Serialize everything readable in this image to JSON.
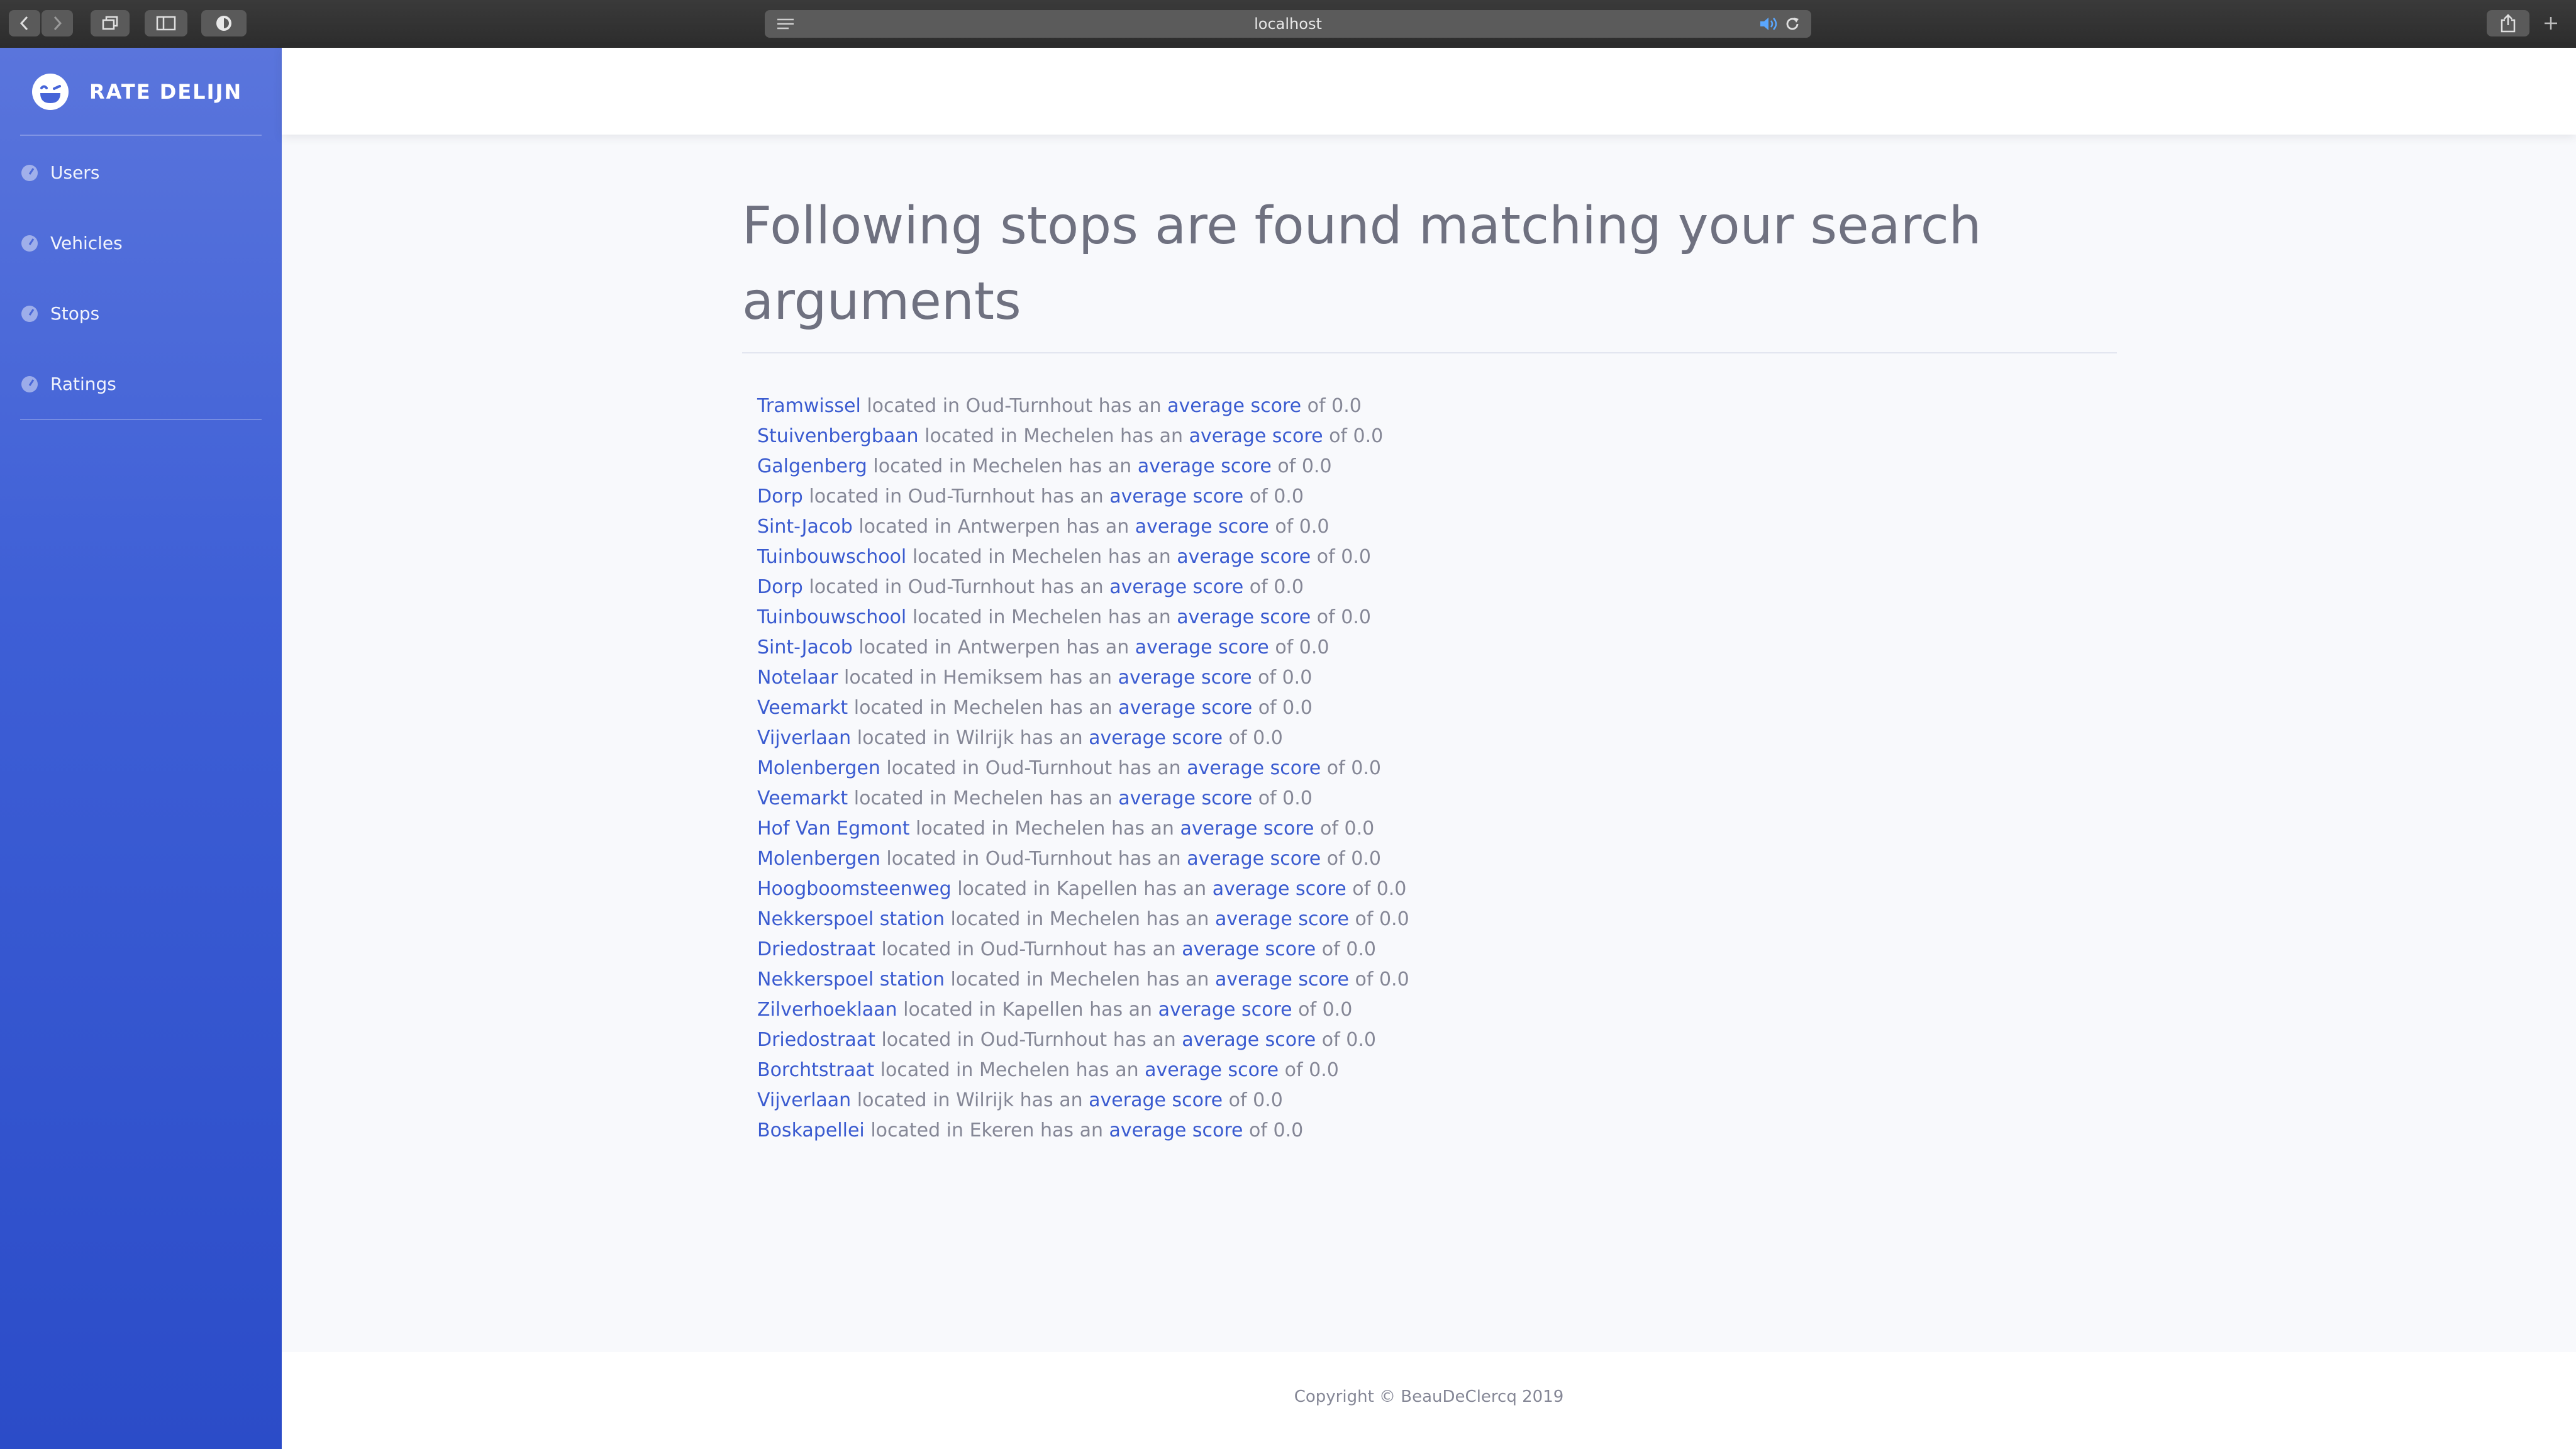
{
  "browser": {
    "url": "localhost"
  },
  "sidebar": {
    "brand": "RATE DELIJN",
    "items": [
      {
        "label": "Users"
      },
      {
        "label": "Vehicles"
      },
      {
        "label": "Stops"
      },
      {
        "label": "Ratings"
      }
    ]
  },
  "main": {
    "heading": "Following stops are found matching your search arguments",
    "results": [
      {
        "stop": "Tramwissel",
        "loc_prefix": "located in",
        "location": "Oud-Turnhout",
        "has": "has an",
        "score_link": "average score",
        "of": "of",
        "score": "0.0"
      },
      {
        "stop": "Stuivenbergbaan",
        "loc_prefix": "located in",
        "location": "Mechelen",
        "has": "has an",
        "score_link": "average score",
        "of": "of",
        "score": "0.0"
      },
      {
        "stop": "Galgenberg",
        "loc_prefix": "located in",
        "location": "Mechelen",
        "has": "has an",
        "score_link": "average score",
        "of": "of",
        "score": "0.0"
      },
      {
        "stop": "Dorp",
        "loc_prefix": "located in",
        "location": "Oud-Turnhout",
        "has": "has an",
        "score_link": "average score",
        "of": "of",
        "score": "0.0"
      },
      {
        "stop": "Sint-Jacob",
        "loc_prefix": "located in",
        "location": "Antwerpen",
        "has": "has an",
        "score_link": "average score",
        "of": "of",
        "score": "0.0"
      },
      {
        "stop": "Tuinbouwschool",
        "loc_prefix": "located in",
        "location": "Mechelen",
        "has": "has an",
        "score_link": "average score",
        "of": "of",
        "score": "0.0"
      },
      {
        "stop": "Dorp",
        "loc_prefix": "located in",
        "location": "Oud-Turnhout",
        "has": "has an",
        "score_link": "average score",
        "of": "of",
        "score": "0.0"
      },
      {
        "stop": "Tuinbouwschool",
        "loc_prefix": "located in",
        "location": "Mechelen",
        "has": "has an",
        "score_link": "average score",
        "of": "of",
        "score": "0.0"
      },
      {
        "stop": "Sint-Jacob",
        "loc_prefix": "located in",
        "location": "Antwerpen",
        "has": "has an",
        "score_link": "average score",
        "of": "of",
        "score": "0.0"
      },
      {
        "stop": "Notelaar",
        "loc_prefix": "located in",
        "location": "Hemiksem",
        "has": "has an",
        "score_link": "average score",
        "of": "of",
        "score": "0.0"
      },
      {
        "stop": "Veemarkt",
        "loc_prefix": "located in",
        "location": "Mechelen",
        "has": "has an",
        "score_link": "average score",
        "of": "of",
        "score": "0.0"
      },
      {
        "stop": "Vijverlaan",
        "loc_prefix": "located in",
        "location": "Wilrijk",
        "has": "has an",
        "score_link": "average score",
        "of": "of",
        "score": "0.0"
      },
      {
        "stop": "Molenbergen",
        "loc_prefix": "located in",
        "location": "Oud-Turnhout",
        "has": "has an",
        "score_link": "average score",
        "of": "of",
        "score": "0.0"
      },
      {
        "stop": "Veemarkt",
        "loc_prefix": "located in",
        "location": "Mechelen",
        "has": "has an",
        "score_link": "average score",
        "of": "of",
        "score": "0.0"
      },
      {
        "stop": "Hof Van Egmont",
        "loc_prefix": "located in",
        "location": "Mechelen",
        "has": "has an",
        "score_link": "average score",
        "of": "of",
        "score": "0.0"
      },
      {
        "stop": "Molenbergen",
        "loc_prefix": "located in",
        "location": "Oud-Turnhout",
        "has": "has an",
        "score_link": "average score",
        "of": "of",
        "score": "0.0"
      },
      {
        "stop": "Hoogboomsteenweg",
        "loc_prefix": "located in",
        "location": "Kapellen",
        "has": "has an",
        "score_link": "average score",
        "of": "of",
        "score": "0.0"
      },
      {
        "stop": "Nekkerspoel station",
        "loc_prefix": "located in",
        "location": "Mechelen",
        "has": "has an",
        "score_link": "average score",
        "of": "of",
        "score": "0.0"
      },
      {
        "stop": "Driedostraat",
        "loc_prefix": "located in",
        "location": "Oud-Turnhout",
        "has": "has an",
        "score_link": "average score",
        "of": "of",
        "score": "0.0"
      },
      {
        "stop": "Nekkerspoel station",
        "loc_prefix": "located in",
        "location": "Mechelen",
        "has": "has an",
        "score_link": "average score",
        "of": "of",
        "score": "0.0"
      },
      {
        "stop": "Zilverhoeklaan",
        "loc_prefix": "located in",
        "location": "Kapellen",
        "has": "has an",
        "score_link": "average score",
        "of": "of",
        "score": "0.0"
      },
      {
        "stop": "Driedostraat",
        "loc_prefix": "located in",
        "location": "Oud-Turnhout",
        "has": "has an",
        "score_link": "average score",
        "of": "of",
        "score": "0.0"
      },
      {
        "stop": "Borchtstraat",
        "loc_prefix": "located in",
        "location": "Mechelen",
        "has": "has an",
        "score_link": "average score",
        "of": "of",
        "score": "0.0"
      },
      {
        "stop": "Vijverlaan",
        "loc_prefix": "located in",
        "location": "Wilrijk",
        "has": "has an",
        "score_link": "average score",
        "of": "of",
        "score": "0.0"
      },
      {
        "stop": "Boskapellei",
        "loc_prefix": "located in",
        "location": "Ekeren",
        "has": "has an",
        "score_link": "average score",
        "of": "of",
        "score": "0.0"
      }
    ]
  },
  "footer": {
    "copyright": "Copyright © BeauDeClercq 2019"
  },
  "colors": {
    "sidebar_top": "#5a75dc",
    "sidebar_bottom": "#2b4cc8",
    "link": "#3a5bd0",
    "text_muted": "#858796",
    "content_bg": "#f8f9fc"
  }
}
